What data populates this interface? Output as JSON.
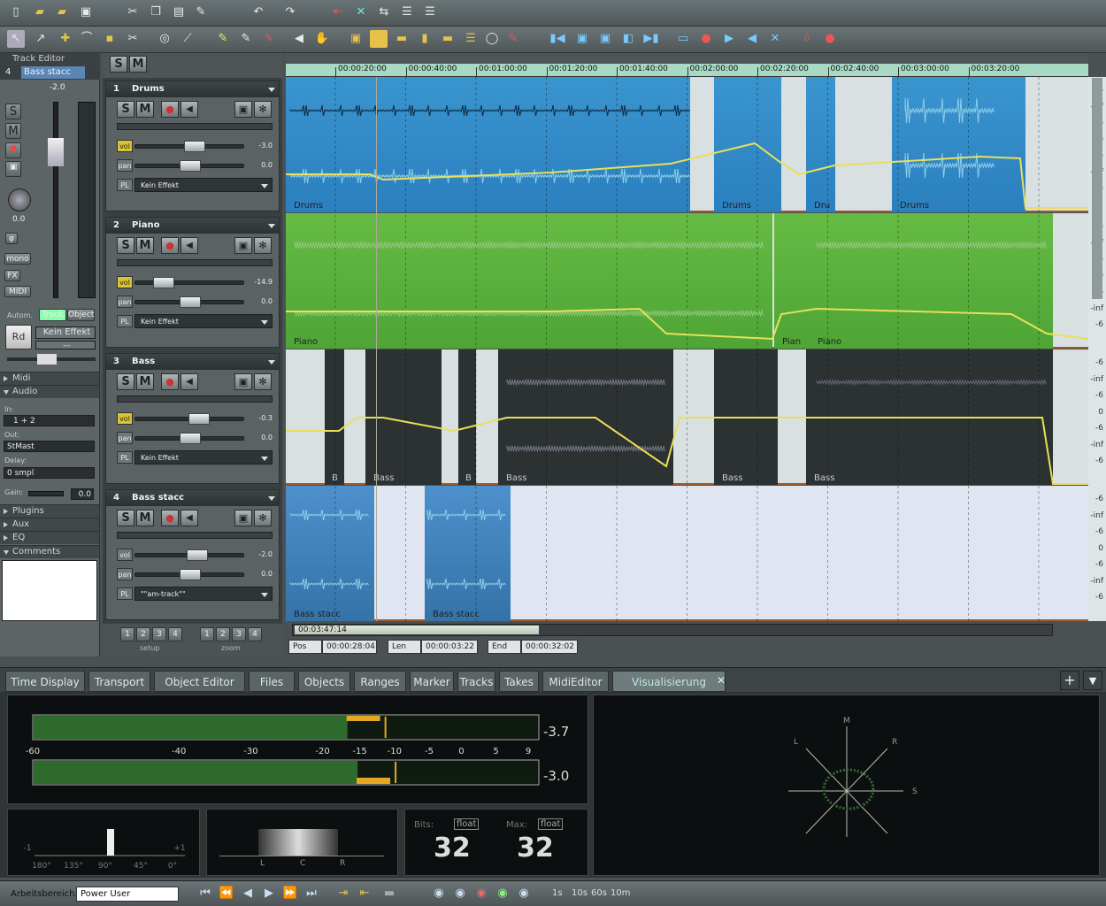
{
  "track_editor": {
    "title": "Track Editor",
    "track_num": "4",
    "track_name": "Bass stacc",
    "vol_top": "-2.0",
    "pan_val": "0.0",
    "buttons": {
      "solo": "S",
      "mute": "M",
      "mono": "mono",
      "fx": "FX",
      "midi": "MIDI",
      "rd": "Rd"
    },
    "autom_label": "Autom.",
    "autom_track": "Track",
    "autom_object": "Object",
    "effect": "Kein Effekt",
    "dash": "---",
    "sections": [
      "Midi",
      "Audio",
      "Plugins",
      "Aux",
      "EQ",
      "Comments"
    ],
    "in_label": "In:",
    "in_value": "1 + 2",
    "out_label": "Out:",
    "out_value": "StMast",
    "delay_label": "Delay:",
    "delay_value": "0 smpl",
    "gain_label": "Gain:",
    "gain_value": "0.0"
  },
  "header_top": {
    "solo": "S",
    "mute": "M"
  },
  "tracks": [
    {
      "num": "1",
      "name": "Drums",
      "vol": "-3.0",
      "pan": "0.0",
      "fx": "Kein Effekt",
      "vol_level": 0.55
    },
    {
      "num": "2",
      "name": "Piano",
      "vol": "-14.9",
      "pan": "0.0",
      "fx": "Kein Effekt",
      "vol_level": 0.2
    },
    {
      "num": "3",
      "name": "Bass",
      "vol": "-0.3",
      "pan": "0.0",
      "fx": "Kein Effekt",
      "vol_level": 0.6
    },
    {
      "num": "4",
      "name": "Bass stacc",
      "vol": "-2.0",
      "pan": "0.0",
      "fx": "\"\"am-track\"\"",
      "vol_level": 0.58
    }
  ],
  "row_labels": {
    "vol": "vol",
    "pan": "pan",
    "pl": "PL"
  },
  "ruler_ticks": [
    "00:00:20:00",
    "00:00:40:00",
    "00:01:00:00",
    "00:01:20:00",
    "00:01:40:00",
    "00:02:00:00",
    "00:02:20:00",
    "00:02:40:00",
    "00:03:00:00",
    "00:03:20:00"
  ],
  "clip_names": {
    "drums1": "Drums",
    "drums2": "Drums",
    "drums3": "Dru",
    "drums4": "Drums",
    "piano1": "Piano",
    "piano2": "Pian",
    "piano3": "Piano",
    "bass1": "B",
    "bass2": "Bass",
    "bass3": "B",
    "bass4": "Bass",
    "bass5": "Bass",
    "bass6": "Bass",
    "bs1": "Bass stacc",
    "bs2": "Bass stacc"
  },
  "db_labels": [
    "-6",
    "-inf",
    "-6",
    "0",
    "-6",
    "-inf",
    "-6"
  ],
  "setup": {
    "setup_label": "setup",
    "zoom_label": "zoom",
    "nums": [
      "1",
      "2",
      "3",
      "4"
    ]
  },
  "position": {
    "scroll": "00:03:47:14",
    "pos_label": "Pos",
    "pos": "00:00:28:04",
    "len_label": "Len",
    "len": "00:00:03:22",
    "end_label": "End",
    "end": "00:00:32:02"
  },
  "tabs": [
    "Time Display",
    "Transport",
    "Object Editor",
    "Files",
    "Objects",
    "Ranges",
    "Marker",
    "Tracks",
    "Takes",
    "MidiEditor",
    "Visualisierung"
  ],
  "meter": {
    "scale": [
      "-60",
      "-40",
      "-30",
      "-20",
      "-15",
      "-10",
      "-5",
      "0",
      "5",
      "9"
    ],
    "peak_top": "-3.7",
    "peak_bottom": "-3.0",
    "level_top": 0.62,
    "level_bottom": 0.64
  },
  "phase": {
    "labels": [
      "-1",
      "180°",
      "135°",
      "90°",
      "45°",
      "0°",
      "+1"
    ]
  },
  "panorama": {
    "labels": [
      "L",
      "C",
      "R"
    ]
  },
  "bits": {
    "bits_label": "Bits:",
    "bits_float": "float",
    "bits_value": "32",
    "max_label": "Max:",
    "max_float": "float",
    "max_value": "32"
  },
  "goniometer": {
    "m": "M",
    "l": "L",
    "r": "R",
    "s": "S"
  },
  "status": {
    "workspace_label": "Arbeitsbereich:",
    "workspace_value": "Power User",
    "zoom_steps": [
      "1s",
      "10s",
      "60s",
      "10m"
    ]
  }
}
